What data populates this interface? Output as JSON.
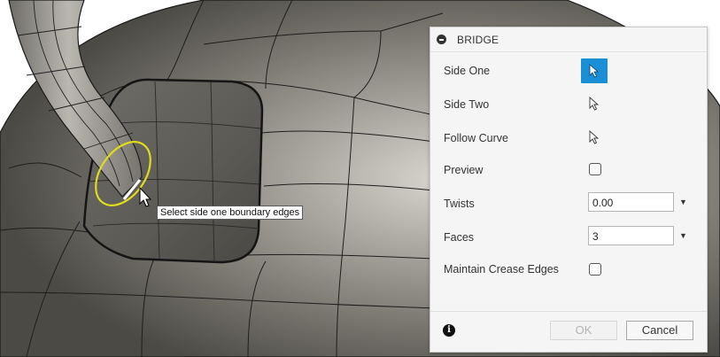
{
  "tooltip": {
    "text": "Select side one boundary edges"
  },
  "panel": {
    "title": "BRIDGE",
    "side_one": {
      "label": "Side One",
      "active": true
    },
    "side_two": {
      "label": "Side Two"
    },
    "follow_curve": {
      "label": "Follow Curve"
    },
    "preview": {
      "label": "Preview",
      "checked": false
    },
    "twists": {
      "label": "Twists",
      "value": "0.00"
    },
    "faces": {
      "label": "Faces",
      "value": "3"
    },
    "maintain_crease": {
      "label": "Maintain Crease Edges",
      "checked": false
    },
    "ok_label": "OK",
    "cancel_label": "Cancel"
  },
  "colors": {
    "accent": "#1b8fd6",
    "selection_ring": "#e0dc1a",
    "surface": "#7d7b74"
  }
}
